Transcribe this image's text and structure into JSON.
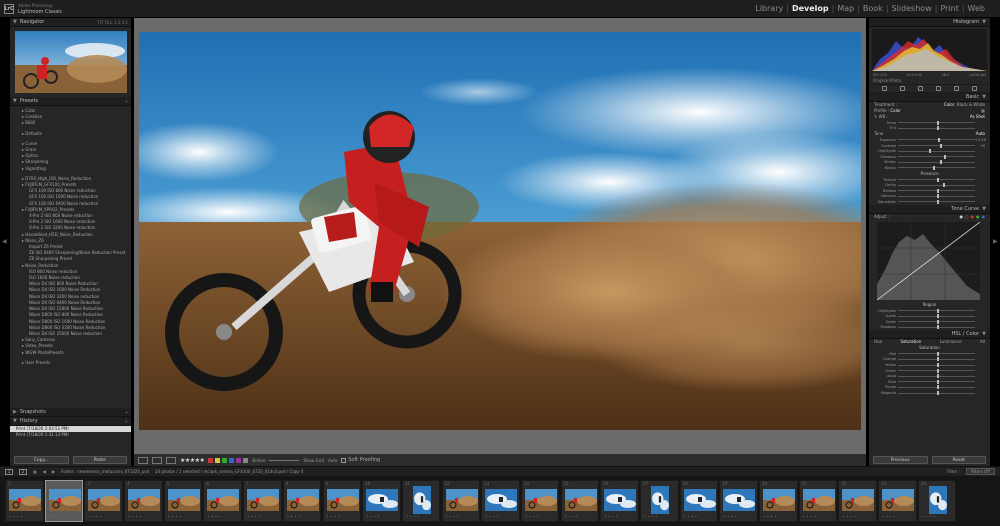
{
  "app": {
    "brand_line1": "Adobe Photoshop",
    "brand_line2": "Lightroom Classic",
    "logo": "LrC",
    "modules": [
      "Library",
      "Develop",
      "Map",
      "Book",
      "Slideshow",
      "Print",
      "Web"
    ],
    "active_module": "Develop"
  },
  "left_panel": {
    "navigator": {
      "title": "Navigator",
      "opts": "FIT  FILL  1:1  3:1"
    },
    "presets": {
      "title": "Presets",
      "items": [
        {
          "label": "Color",
          "lvl": 1
        },
        {
          "label": "Creative",
          "lvl": 1
        },
        {
          "label": "B&W",
          "lvl": 1
        },
        {
          "label": "Defaults",
          "lvl": 1,
          "gap": true
        },
        {
          "label": "Curve",
          "lvl": 1,
          "gap": true
        },
        {
          "label": "Grain",
          "lvl": 1
        },
        {
          "label": "Optics",
          "lvl": 1
        },
        {
          "label": "Sharpening",
          "lvl": 1
        },
        {
          "label": "Vignetting",
          "lvl": 1
        },
        {
          "label": "D700_High_ISO_Noise_Reduction",
          "lvl": 1,
          "gap": true
        },
        {
          "label": "FUJIFILM_GFX100_Presets",
          "lvl": 1
        },
        {
          "label": "GFX 100 ISO 800 Noise reduction",
          "lvl": 2
        },
        {
          "label": "GFX 100 ISO 1600 Noise reduction",
          "lvl": 2
        },
        {
          "label": "GFX 100 ISO 6400 Noise reduction",
          "lvl": 2
        },
        {
          "label": "FUJIFILM_XPRO2_Presets",
          "lvl": 1
        },
        {
          "label": "X-Pro 2 ISO 800 Noise reduction",
          "lvl": 2
        },
        {
          "label": "X-Pro 2 ISO 1600 Noise reduction",
          "lvl": 2
        },
        {
          "label": "X-Pro 2 ISO 3200 Noise reduction",
          "lvl": 2
        },
        {
          "label": "Hasselblad_H5D_Noise_Reduction",
          "lvl": 1
        },
        {
          "label": "Nikon_Z6",
          "lvl": 1
        },
        {
          "label": "Import Z6 Preset",
          "lvl": 2
        },
        {
          "label": "Z6 ISO 6400 Sharpening/Noise Reduction Preset",
          "lvl": 2
        },
        {
          "label": "Z6 Sharpening Preset",
          "lvl": 2
        },
        {
          "label": "Noise_Reduction",
          "lvl": 1
        },
        {
          "label": "ISO 800 Noise reduction",
          "lvl": 2
        },
        {
          "label": "ISO 1600 Noise reduction",
          "lvl": 2
        },
        {
          "label": "Nikon D4 ISO 800 Noise Reduction",
          "lvl": 2
        },
        {
          "label": "Nikon D4 ISO 1600 Noise Reduction",
          "lvl": 2
        },
        {
          "label": "Nikon D4 ISO 3200 Noise reduction",
          "lvl": 2
        },
        {
          "label": "Nikon D4 ISO 6400 Noise Reduction",
          "lvl": 2
        },
        {
          "label": "Nikon D4 ISO 12800 Noise Reduction",
          "lvl": 2
        },
        {
          "label": "Nikon D800 ISO 800 Noise Reduction",
          "lvl": 2
        },
        {
          "label": "Nikon D800 ISO 1600 Noise Reduction",
          "lvl": 2
        },
        {
          "label": "Nikon D800 ISO 3200 Noise Reduction",
          "lvl": 2
        },
        {
          "label": "Nikon D4 ISO 25600 Noise reduction",
          "lvl": 2
        },
        {
          "label": "Sony_Cameras",
          "lvl": 1
        },
        {
          "label": "Video_Presets",
          "lvl": 1
        },
        {
          "label": "WGW PhotoPresets",
          "lvl": 1
        },
        {
          "label": "User Presets",
          "lvl": 1,
          "gap": true
        }
      ]
    },
    "snapshots_title": "Snapshots",
    "history": {
      "title": "History",
      "items": [
        {
          "label": "Print (7/18/20 2:03:51 PM)",
          "selected": true
        },
        {
          "label": "Print (7/18/20 1:31:13 PM)",
          "selected": false
        }
      ]
    },
    "copy_label": "Copy...",
    "paste_label": "Paste"
  },
  "toolbar": {
    "stars": "★★★★★",
    "swatch_colors": [
      "#c33",
      "#cc3",
      "#3a3",
      "#36c",
      "#939",
      "#888"
    ],
    "label_before": "Before",
    "label_show_grid": "Show Grid",
    "label_auto": "Auto",
    "soft_proofing": "Soft Proofing"
  },
  "right_panel": {
    "histogram_title": "Histogram",
    "histo_vals": [
      "ISO 200",
      "35.5 mm",
      "f/8.0",
      "1/500 sec"
    ],
    "original_photo": "Original Photo",
    "basic": {
      "title": "Basic",
      "treatment_label": "Treatment :",
      "treatment_color": "Color",
      "treatment_bw": "Black & White",
      "profile_label": "Profile :",
      "profile_value": "Color",
      "wb_label": "WB :",
      "wb_value": "As Shot",
      "rows_a": [
        {
          "l": "Temp",
          "p": 0.5
        },
        {
          "l": "Tint",
          "p": 0.5
        }
      ],
      "tone_label": "Tone",
      "auto_label": "Auto",
      "rows_b": [
        {
          "l": "Exposure",
          "p": 0.52,
          "v": "+0.28"
        },
        {
          "l": "Contrast",
          "p": 0.55,
          "v": "+6"
        }
      ],
      "rows_c": [
        {
          "l": "Highlights",
          "p": 0.4
        },
        {
          "l": "Shadows",
          "p": 0.6
        },
        {
          "l": "Whites",
          "p": 0.55
        },
        {
          "l": "Blacks",
          "p": 0.45
        }
      ],
      "presence_label": "Presence",
      "rows_d": [
        {
          "l": "Texture",
          "p": 0.5
        },
        {
          "l": "Clarity",
          "p": 0.58
        },
        {
          "l": "Dehaze",
          "p": 0.5
        }
      ],
      "rows_e": [
        {
          "l": "Vibrance",
          "p": 0.5
        },
        {
          "l": "Saturation",
          "p": 0.5
        }
      ]
    },
    "tone_curve": {
      "title": "Tone Curve",
      "adjust_label": "Adjust :",
      "region_label": "Region",
      "rows": [
        {
          "l": "Highlights",
          "p": 0.5
        },
        {
          "l": "Lights",
          "p": 0.5
        },
        {
          "l": "Darks",
          "p": 0.5
        },
        {
          "l": "Shadows",
          "p": 0.5
        }
      ]
    },
    "hsl": {
      "title": "HSL / Color",
      "tabs": [
        "Hue",
        "Saturation",
        "Luminance",
        "All"
      ],
      "active_tab": "Saturation",
      "sub_label": "Saturation",
      "rows": [
        {
          "l": "Red",
          "p": 0.5
        },
        {
          "l": "Orange",
          "p": 0.5
        },
        {
          "l": "Yellow",
          "p": 0.5
        },
        {
          "l": "Green",
          "p": 0.5
        },
        {
          "l": "Aqua",
          "p": 0.5
        },
        {
          "l": "Blue",
          "p": 0.5
        },
        {
          "l": "Purple",
          "p": 0.5
        },
        {
          "l": "Magenta",
          "p": 0.5
        }
      ]
    },
    "previous_label": "Previous",
    "reset_label": "Reset"
  },
  "filmstrip_bar": {
    "page1": "1",
    "page2": "2",
    "folder_text": "Folder : newmexico_motocross_071320_psd",
    "count_text": "24 photos / 1 selected / mclark_serena_GFX100_0720_014v3.psd / Copy 4",
    "filter_label": "Filter :",
    "filter_value": "Filters Off"
  },
  "filmstrip": {
    "thumbs": [
      {
        "n": "1",
        "t": "moto"
      },
      {
        "n": "2",
        "t": "moto",
        "sel": true
      },
      {
        "n": "3",
        "t": "moto"
      },
      {
        "n": "4",
        "t": "moto"
      },
      {
        "n": "5",
        "t": "moto"
      },
      {
        "n": "6",
        "t": "moto"
      },
      {
        "n": "7",
        "t": "moto"
      },
      {
        "n": "8",
        "t": "moto"
      },
      {
        "n": "9",
        "t": "moto"
      },
      {
        "n": "10",
        "t": "sky"
      },
      {
        "n": "11",
        "t": "sky-p"
      },
      {
        "n": "12",
        "t": "moto"
      },
      {
        "n": "13",
        "t": "sky"
      },
      {
        "n": "14",
        "t": "moto"
      },
      {
        "n": "15",
        "t": "moto"
      },
      {
        "n": "16",
        "t": "sky"
      },
      {
        "n": "17",
        "t": "sky-p"
      },
      {
        "n": "18",
        "t": "sky"
      },
      {
        "n": "19",
        "t": "sky"
      },
      {
        "n": "20",
        "t": "moto"
      },
      {
        "n": "21",
        "t": "moto"
      },
      {
        "n": "22",
        "t": "moto"
      },
      {
        "n": "23",
        "t": "moto"
      },
      {
        "n": "24",
        "t": "sky-p"
      }
    ]
  }
}
